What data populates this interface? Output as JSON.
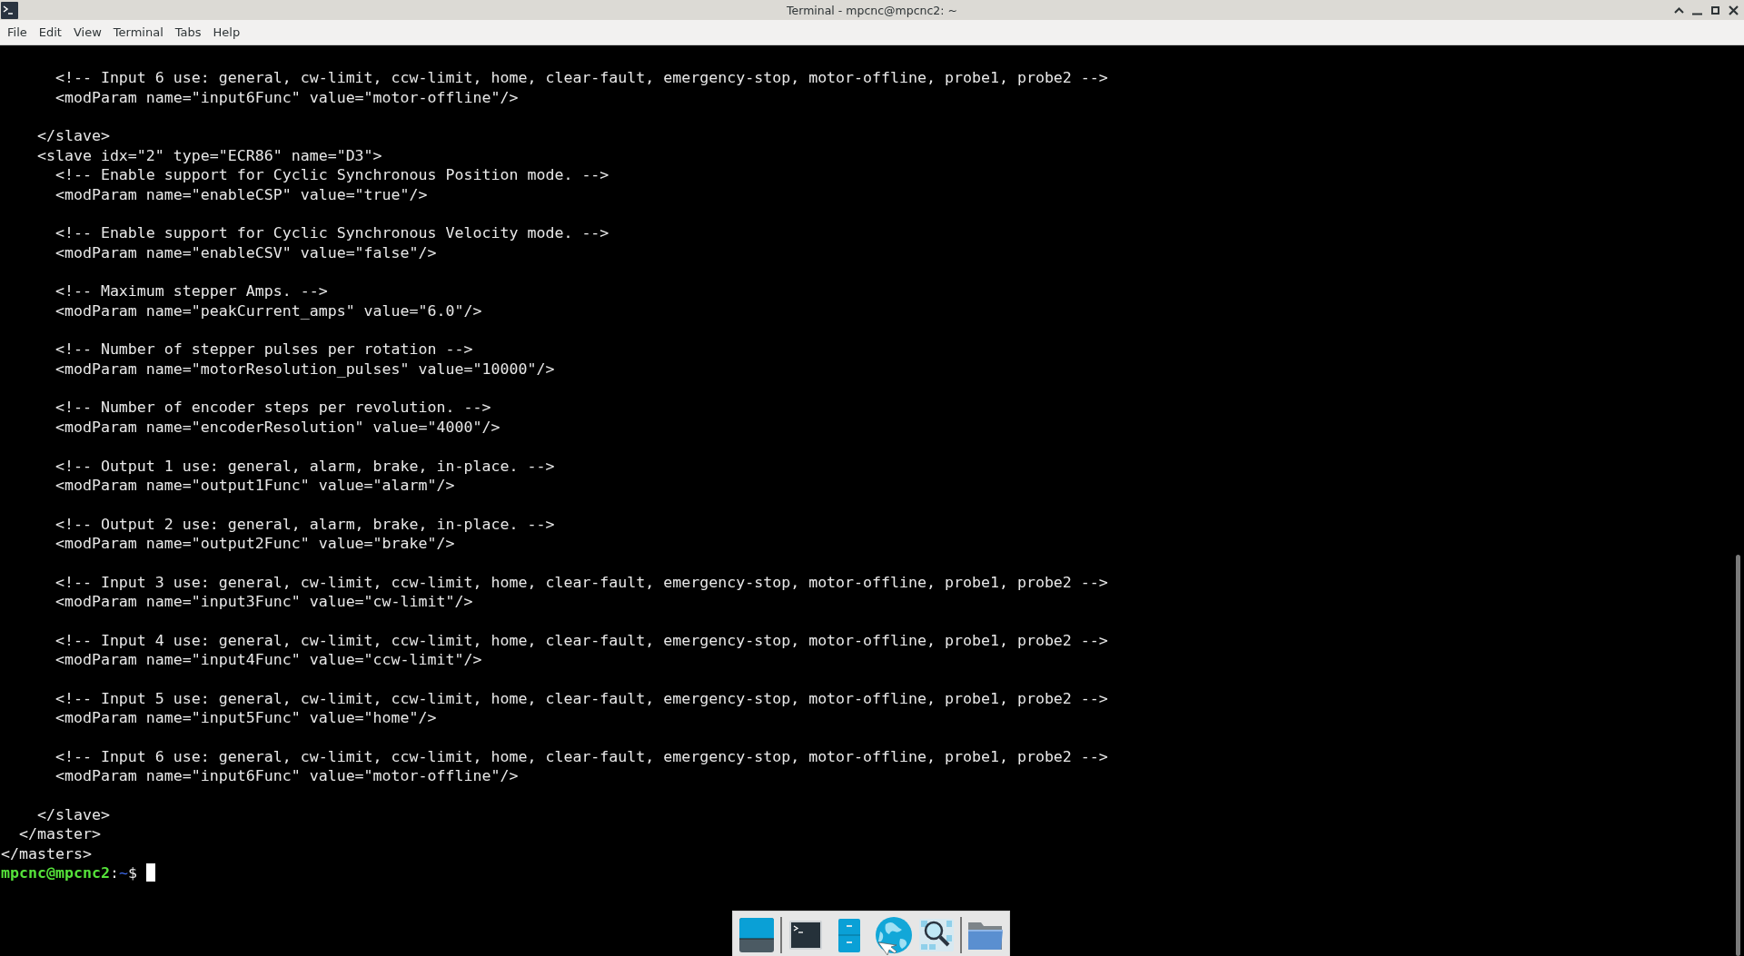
{
  "window": {
    "title": "Terminal - mpcnc@mpcnc2: ~"
  },
  "menu": [
    "File",
    "Edit",
    "View",
    "Terminal",
    "Tabs",
    "Help"
  ],
  "terminal": {
    "blocks": [
      [
        "      <!-- Input 6 use: general, cw-limit, ccw-limit, home, clear-fault, emergency-stop, motor-offline, probe1, probe2 -->",
        "      <modParam name=\"input6Func\" value=\"motor-offline\"/>"
      ],
      [
        "    </slave>",
        "    <slave idx=\"2\" type=\"ECR86\" name=\"D3\">",
        "      <!-- Enable support for Cyclic Synchronous Position mode. -->",
        "      <modParam name=\"enableCSP\" value=\"true\"/>"
      ],
      [
        "      <!-- Enable support for Cyclic Synchronous Velocity mode. -->",
        "      <modParam name=\"enableCSV\" value=\"false\"/>"
      ],
      [
        "      <!-- Maximum stepper Amps. -->",
        "      <modParam name=\"peakCurrent_amps\" value=\"6.0\"/>"
      ],
      [
        "      <!-- Number of stepper pulses per rotation -->",
        "      <modParam name=\"motorResolution_pulses\" value=\"10000\"/>"
      ],
      [
        "      <!-- Number of encoder steps per revolution. -->",
        "      <modParam name=\"encoderResolution\" value=\"4000\"/>"
      ],
      [
        "      <!-- Output 1 use: general, alarm, brake, in-place. -->",
        "      <modParam name=\"output1Func\" value=\"alarm\"/>"
      ],
      [
        "      <!-- Output 2 use: general, alarm, brake, in-place. -->",
        "      <modParam name=\"output2Func\" value=\"brake\"/>"
      ],
      [
        "      <!-- Input 3 use: general, cw-limit, ccw-limit, home, clear-fault, emergency-stop, motor-offline, probe1, probe2 -->",
        "      <modParam name=\"input3Func\" value=\"cw-limit\"/>"
      ],
      [
        "      <!-- Input 4 use: general, cw-limit, ccw-limit, home, clear-fault, emergency-stop, motor-offline, probe1, probe2 -->",
        "      <modParam name=\"input4Func\" value=\"ccw-limit\"/>"
      ],
      [
        "      <!-- Input 5 use: general, cw-limit, ccw-limit, home, clear-fault, emergency-stop, motor-offline, probe1, probe2 -->",
        "      <modParam name=\"input5Func\" value=\"home\"/>"
      ],
      [
        "      <!-- Input 6 use: general, cw-limit, ccw-limit, home, clear-fault, emergency-stop, motor-offline, probe1, probe2 -->",
        "      <modParam name=\"input6Func\" value=\"motor-offline\"/>"
      ],
      [
        "    </slave>",
        "  </master>",
        "</masters>"
      ]
    ],
    "prompt": {
      "user_host": "mpcnc@mpcnc2",
      "separator": ":",
      "path": "~",
      "symbol": "$"
    }
  },
  "dock": {
    "items": [
      {
        "kind": "desktop"
      },
      {
        "kind": "separator"
      },
      {
        "kind": "terminal"
      },
      {
        "kind": "cabinet"
      },
      {
        "kind": "globe"
      },
      {
        "kind": "finder"
      },
      {
        "kind": "separator"
      },
      {
        "kind": "folder"
      }
    ]
  }
}
